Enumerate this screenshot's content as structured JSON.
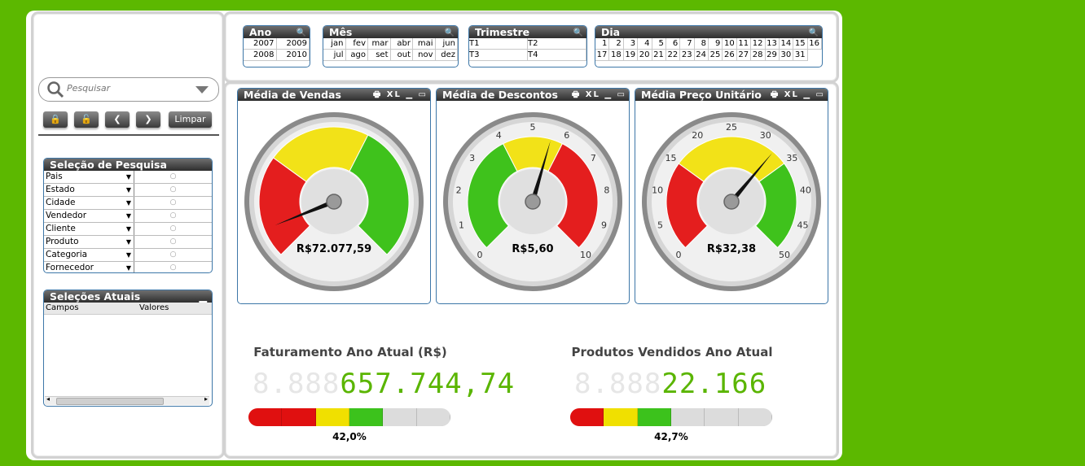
{
  "search": {
    "placeholder": "Pesquisar"
  },
  "toolbar": {
    "clear_label": "Limpar"
  },
  "filters": {
    "year": {
      "title": "Ano",
      "values": [
        "2007",
        "2009",
        "2008",
        "2010"
      ]
    },
    "month": {
      "title": "Mês",
      "values": [
        "jan",
        "fev",
        "mar",
        "abr",
        "mai",
        "jun",
        "jul",
        "ago",
        "set",
        "out",
        "nov",
        "dez"
      ]
    },
    "quarter": {
      "title": "Trimestre",
      "values": [
        "T1",
        "T2",
        "T3",
        "T4"
      ]
    },
    "day": {
      "title": "Dia",
      "values": [
        "1",
        "2",
        "3",
        "4",
        "5",
        "6",
        "7",
        "8",
        "9",
        "10",
        "11",
        "12",
        "13",
        "14",
        "15",
        "16",
        "17",
        "18",
        "19",
        "20",
        "21",
        "22",
        "23",
        "24",
        "25",
        "26",
        "27",
        "28",
        "29",
        "30",
        "31"
      ]
    }
  },
  "search_selection": {
    "title": "Seleção de Pesquisa",
    "fields": [
      "Pais",
      "Estado",
      "Cidade",
      "Vendedor",
      "Cliente",
      "Produto",
      "Categoria",
      "Fornecedor"
    ]
  },
  "current_selections": {
    "title": "Seleções Atuais",
    "col_fields": "Campos",
    "col_values": "Valores"
  },
  "gauge_header_icons": "🖶 XL ▁ ▭",
  "gauges": [
    {
      "title": "Média de Vendas",
      "value_label": "R$72.077,59",
      "min": 0,
      "max": 10,
      "value": 0.86,
      "ticks": [],
      "bands": [
        "#e41e1e",
        "#f2e218",
        "#3fc21c"
      ],
      "band_split": [
        0.0,
        0.3,
        0.6,
        1.0
      ]
    },
    {
      "title": "Média de Descontos",
      "value_label": "R$5,60",
      "min": 0,
      "max": 10,
      "value": 5.6,
      "ticks": [
        "0",
        "1",
        "2",
        "3",
        "4",
        "5",
        "6",
        "7",
        "8",
        "9",
        "10"
      ],
      "bands": [
        "#3fc21c",
        "#f2e218",
        "#e41e1e"
      ],
      "band_split": [
        0.0,
        0.4,
        0.6,
        1.0
      ]
    },
    {
      "title": "Média Preço Unitário",
      "value_label": "R$32,38",
      "min": 0,
      "max": 50,
      "value": 32.38,
      "ticks": [
        "0",
        "5",
        "10",
        "15",
        "20",
        "25",
        "30",
        "35",
        "40",
        "45",
        "50"
      ],
      "bands": [
        "#e41e1e",
        "#f2e218",
        "#3fc21c"
      ],
      "band_split": [
        0.0,
        0.3,
        0.7,
        1.0
      ]
    }
  ],
  "kpis": [
    {
      "title": "Faturamento Ano Atual (R$)",
      "ghost": "8.888",
      "digits": "657.744,74",
      "percent": 42.0,
      "percent_label": "42,0%",
      "segments": [
        "#e01010",
        "#e01010",
        "#f0e000",
        "#3cc21c",
        "#dcdcdc",
        "#dcdcdc"
      ]
    },
    {
      "title": "Produtos Vendidos Ano Atual",
      "ghost": "8.888",
      "digits": "22.166",
      "percent": 42.7,
      "percent_label": "42,7%",
      "segments": [
        "#e01010",
        "#f0e000",
        "#3cc21c",
        "#dcdcdc",
        "#dcdcdc",
        "#dcdcdc"
      ]
    }
  ]
}
